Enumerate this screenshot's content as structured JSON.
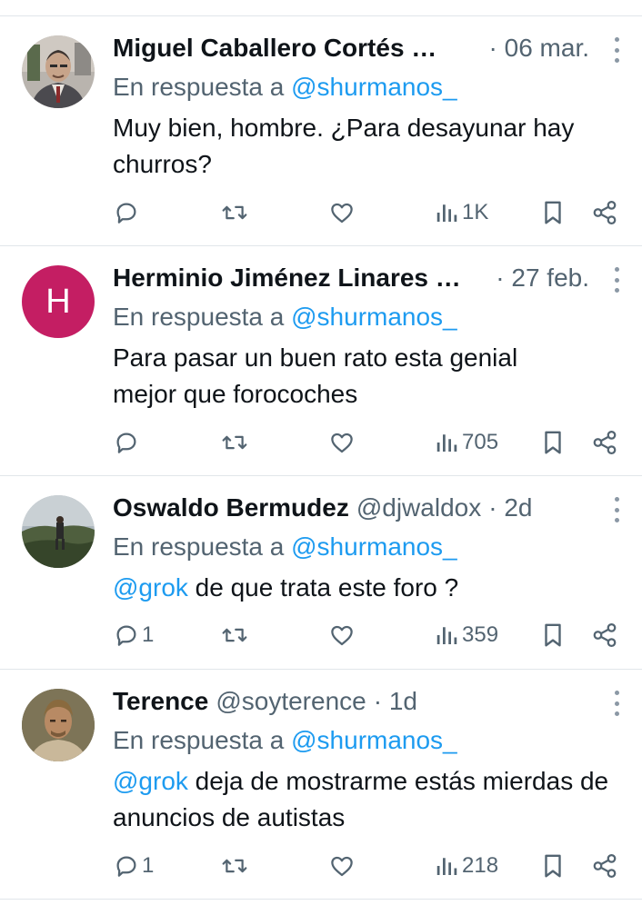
{
  "tweets": [
    {
      "name": "Miguel Caballero Cortés …",
      "handle": "",
      "time": "· 06 mar.",
      "reply_prefix": "En respuesta a",
      "reply_handle": "@shurmanos_",
      "body_mention": "",
      "body_text": "Muy bien, hombre. ¿Para desayunar hay churros?",
      "replies": "",
      "views": "1K",
      "avatar": "photo-man-suit"
    },
    {
      "name": "Herminio Jiménez Linares …",
      "handle": "",
      "time": "· 27 feb.",
      "reply_prefix": "En respuesta a",
      "reply_handle": "@shurmanos_",
      "body_mention": "",
      "body_text": "Para pasar un buen rato esta genial mejor que forocoches",
      "replies": "",
      "views": "705",
      "avatar_letter": "H",
      "avatar_color": "#c41e63"
    },
    {
      "name": "Oswaldo Bermudez",
      "handle": "@djwaldox",
      "time": "· 2d",
      "reply_prefix": "En respuesta a",
      "reply_handle": "@shurmanos_",
      "body_mention": "@grok",
      "body_text": " de que trata este foro ?",
      "replies": "1",
      "views": "359",
      "avatar": "photo-landscape"
    },
    {
      "name": "Terence",
      "handle": "@soyterence",
      "time": "· 1d",
      "reply_prefix": "En respuesta a",
      "reply_handle": "@shurmanos_",
      "body_mention": "@grok",
      "body_text": " deja de mostrarme estás mierdas de anuncios de autistas",
      "replies": "1",
      "views": "218",
      "avatar": "photo-man-portrait"
    }
  ],
  "icons": {
    "reply": "reply-icon",
    "retweet": "retweet-icon",
    "like": "like-icon",
    "views": "views-icon",
    "bookmark": "bookmark-icon",
    "share": "share-icon",
    "more": "more-icon"
  },
  "colors": {
    "text": "#0f1419",
    "secondary": "#536471",
    "link": "#1d9bf0",
    "divider": "#e1e6ea"
  }
}
